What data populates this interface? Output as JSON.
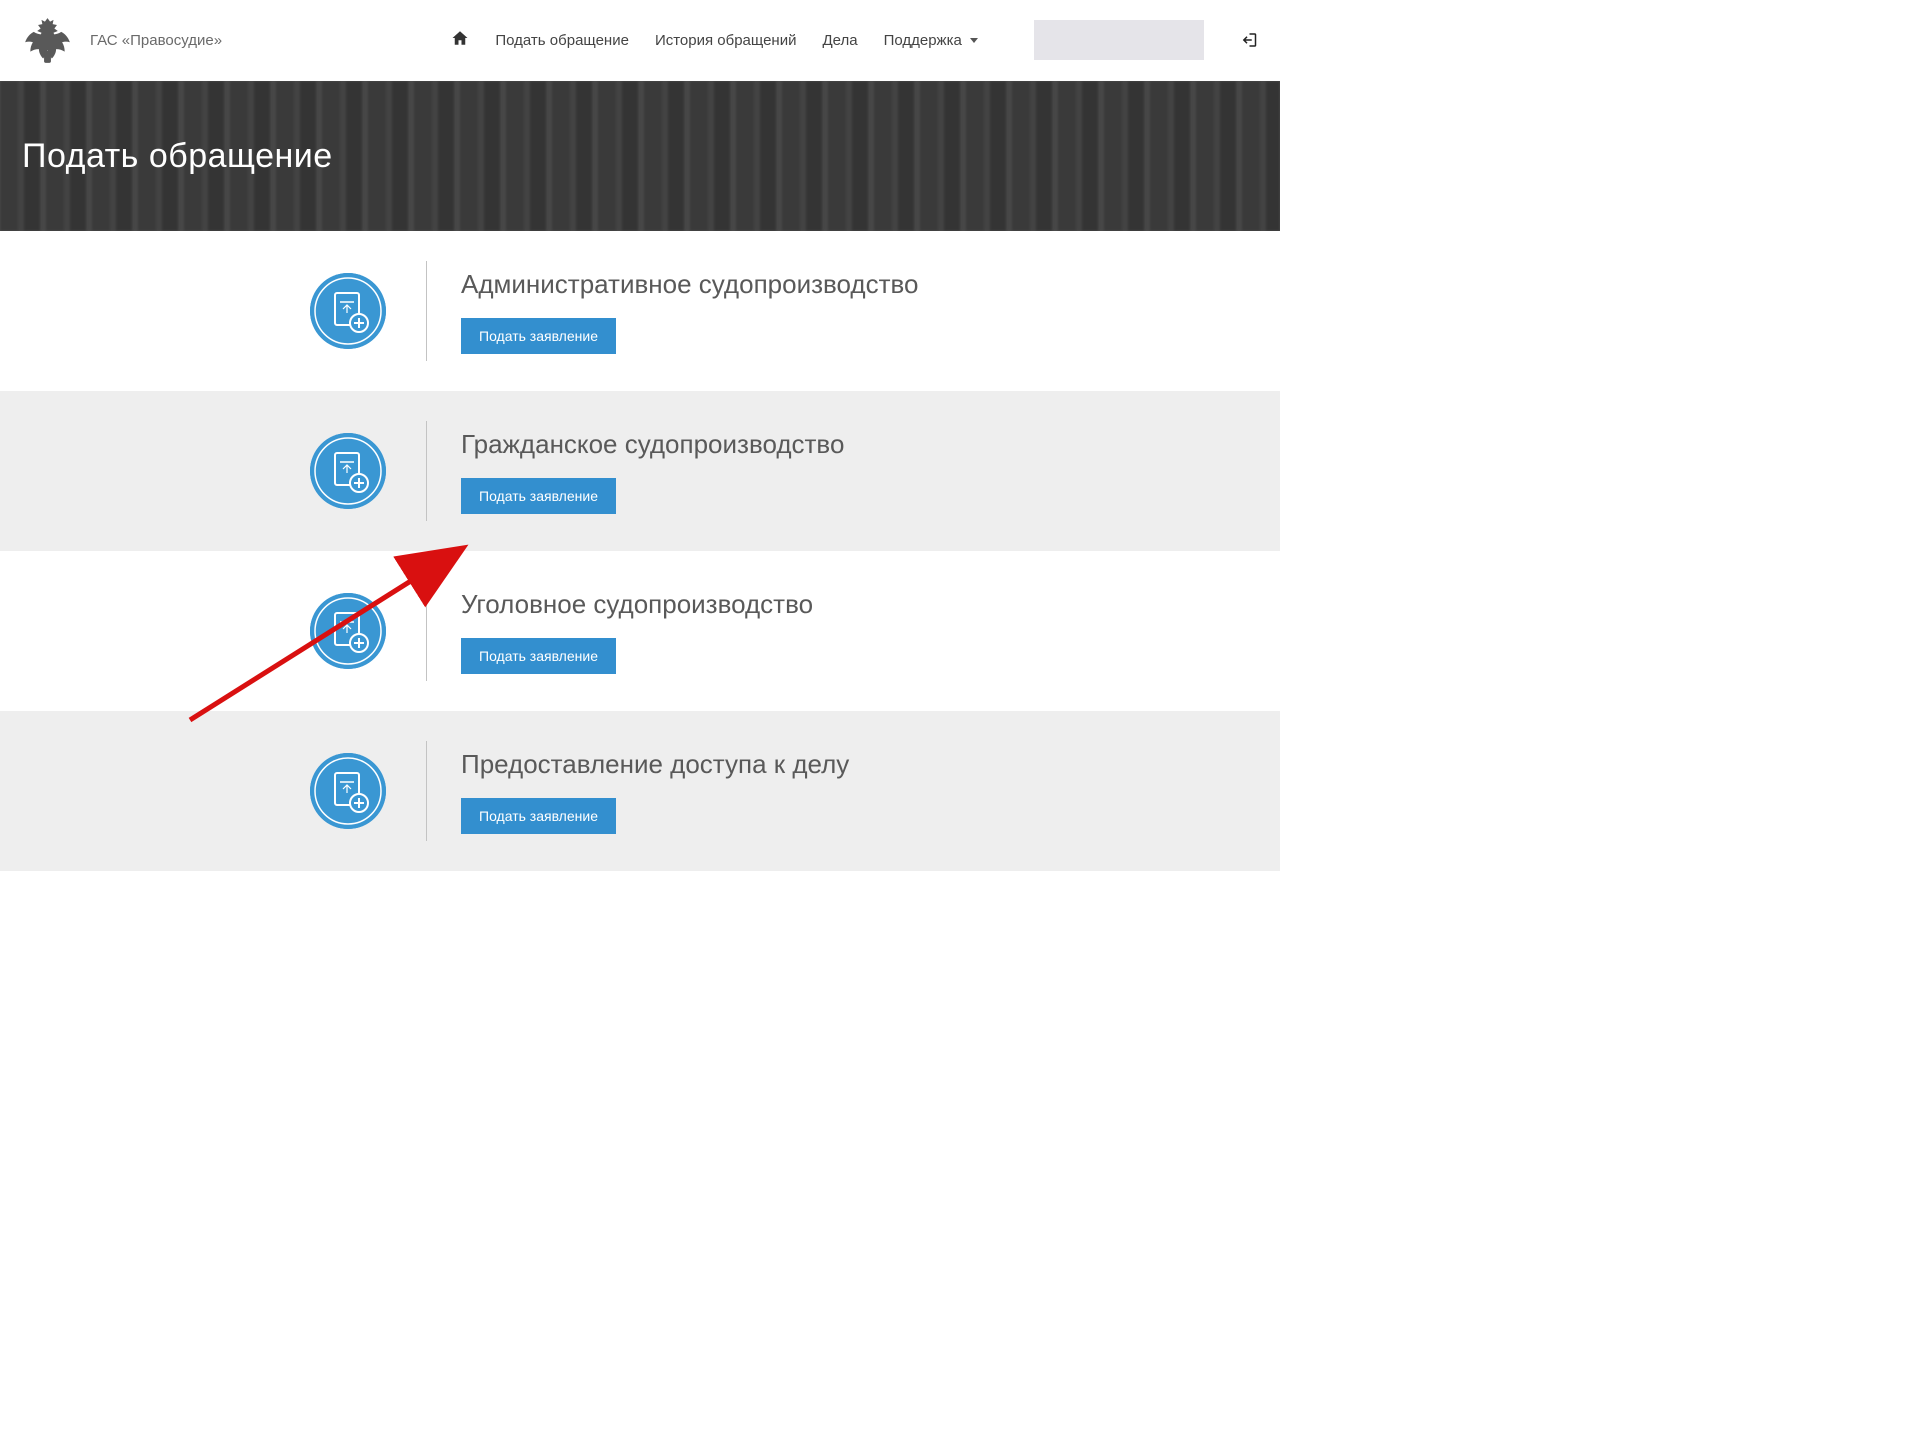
{
  "header": {
    "brand": "ГАС «Правосудие»",
    "nav": {
      "submit": "Подать обращение",
      "history": "История обращений",
      "cases": "Дела",
      "support": "Поддержка"
    }
  },
  "hero": {
    "title": "Подать обращение"
  },
  "sections": [
    {
      "title": "Административное судопроизводство",
      "button": "Подать заявление",
      "alt": false
    },
    {
      "title": "Гражданское судопроизводство",
      "button": "Подать заявление",
      "alt": true
    },
    {
      "title": "Уголовное судопроизводство",
      "button": "Подать заявление",
      "alt": false
    },
    {
      "title": "Предоставление доступа к делу",
      "button": "Подать заявление",
      "alt": true
    }
  ]
}
